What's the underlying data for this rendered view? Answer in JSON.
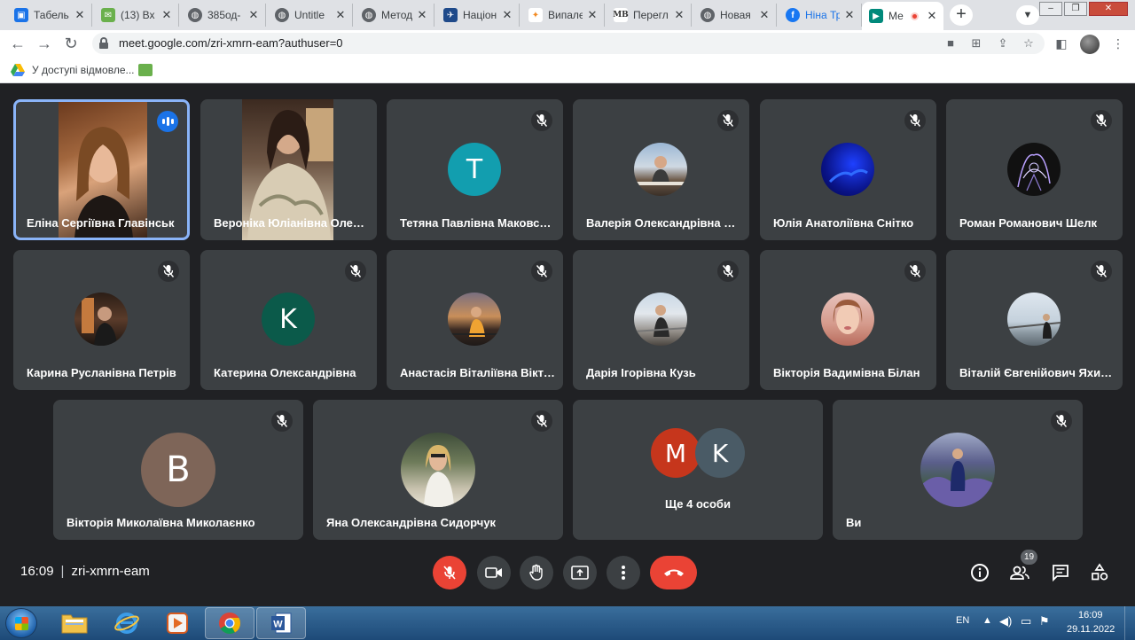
{
  "browser": {
    "tabs": [
      {
        "title": "Табель",
        "icon": "contacts-icon",
        "color": "#1a73e8"
      },
      {
        "title": "(13) Вх",
        "icon": "mail-icon",
        "color": "#6ab04c"
      },
      {
        "title": "385од-",
        "icon": "globe-icon",
        "color": "#5f6368"
      },
      {
        "title": "Untitle",
        "icon": "globe-icon",
        "color": "#5f6368"
      },
      {
        "title": "Метод",
        "icon": "globe-icon",
        "color": "#5f6368"
      },
      {
        "title": "Націон",
        "icon": "plane-icon",
        "color": "#1f4a8a"
      },
      {
        "title": "Випалє",
        "icon": "figure-icon",
        "color": "#f28b24"
      },
      {
        "title": "Перегл",
        "icon": "mb-logo-icon",
        "color": "#555555"
      },
      {
        "title": "Новая",
        "icon": "globe-icon",
        "color": "#5f6368"
      },
      {
        "title": "Ніна Тр",
        "icon": "facebook-icon",
        "color": "#1877f2"
      },
      {
        "title": "Ме",
        "icon": "meet-icon",
        "color": "#00897b",
        "active": true
      }
    ],
    "new_tab": "+",
    "url": "meet.google.com/zri-xmrn-eam?authuser=0",
    "bookmarks": [
      {
        "label": "У доступі відмовле..."
      },
      {
        "label": ""
      }
    ]
  },
  "meet": {
    "participants": [
      {
        "name": "Еліна Сергіївна Главінськ",
        "kind": "video",
        "speaking": true
      },
      {
        "name": "Вероніка Юліанівна Олександрівна",
        "kind": "video"
      },
      {
        "name": "Тетяна Павлівна Маковська",
        "kind": "letter",
        "initial": "T",
        "color": "#129eaf"
      },
      {
        "name": "Валерія Олександрівна Олександрівна",
        "kind": "photo"
      },
      {
        "name": "Юлія Анатоліївна Снітко",
        "kind": "photo"
      },
      {
        "name": "Роман Романович Шелк",
        "kind": "photo"
      },
      {
        "name": "Карина Русланівна Петрів",
        "kind": "photo"
      },
      {
        "name": "Катерина Олександрівна",
        "kind": "letter",
        "initial": "K",
        "color": "#0b5a4a"
      },
      {
        "name": "Анастасія Віталіївна Вікторівна",
        "kind": "photo"
      },
      {
        "name": "Дарія Ігорівна Кузь",
        "kind": "photo"
      },
      {
        "name": "Вікторія Вадимівна Білан",
        "kind": "photo"
      },
      {
        "name": "Віталій Євгенійович Яхимович",
        "kind": "photo"
      },
      {
        "name": "Вікторія Миколаївна Миколаєнко",
        "kind": "letter",
        "initial": "B",
        "color": "#7e6558"
      },
      {
        "name": "Яна Олександрівна Сидорчук",
        "kind": "photo"
      },
      {
        "name": "Ви",
        "kind": "photo"
      }
    ],
    "more": {
      "label": "Ще 4 особи",
      "initials": [
        "M",
        "K"
      ],
      "colors": [
        "#c6361c",
        "#4a5b66"
      ]
    },
    "time": "16:09",
    "meeting_code": "zri-xmrn-eam",
    "people_count": "19"
  },
  "taskbar": {
    "lang": "EN",
    "time": "16:09",
    "date": "29.11.2022"
  }
}
